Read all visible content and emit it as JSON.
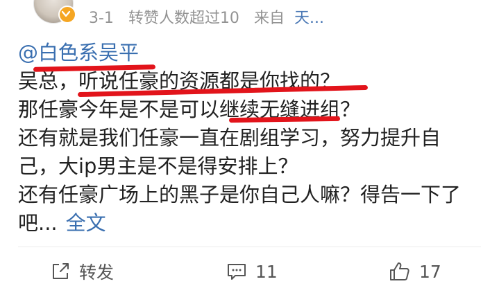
{
  "header": {
    "date": "3-1",
    "repost_note": "转赞人数超过10",
    "source_prefix": "来自",
    "source": "天..."
  },
  "post": {
    "mention": "@白色系吴平",
    "lines": [
      "吴总，听说任豪的资源都是你找的？",
      "那任豪今年是不是可以继续无缝进组？",
      "还有就是我们任豪一直在剧组学习，努力提升自",
      "己，大ip男主是不是得安排上？",
      "还有任豪广场上的黑子是你自己人嘛？得告一下了"
    ],
    "last_line": "吧...",
    "full_text_link": "全文"
  },
  "actions": {
    "repost_label": "转发",
    "comment_count": "11",
    "like_count": "17"
  },
  "colors": {
    "link": "#3a6fb0",
    "marker": "#e2141b",
    "meta": "#939393",
    "badge": "#f5a623"
  }
}
